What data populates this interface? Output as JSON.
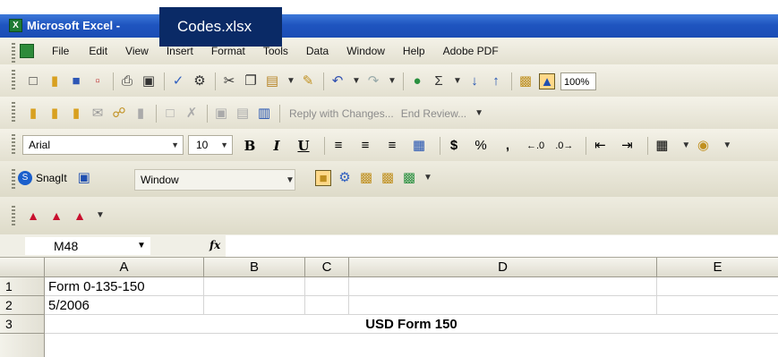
{
  "window": {
    "app_title": "Microsoft Excel -",
    "file_name": "Codes.xlsx",
    "app_icon": "X"
  },
  "menu": {
    "items": [
      "File",
      "Edit",
      "View",
      "Insert",
      "Format",
      "Tools",
      "Data",
      "Window",
      "Help",
      "Adobe PDF"
    ]
  },
  "standard_toolbar": {
    "zoom": "100%"
  },
  "reviewing_toolbar": {
    "reply_label": "Reply with Changes...",
    "end_review_label": "End Review..."
  },
  "formatting_toolbar": {
    "font": "Arial",
    "size": "10",
    "bold": "B",
    "italic": "I",
    "underline": "U",
    "currency": "$",
    "percent": "%",
    "comma": ","
  },
  "snagit_toolbar": {
    "label": "SnagIt",
    "window_select": "Window"
  },
  "formula_bar": {
    "name_box": "M48",
    "fx": "fx",
    "content": ""
  },
  "grid": {
    "columns": [
      "A",
      "B",
      "C",
      "D",
      "E"
    ],
    "rows": [
      {
        "num": "1",
        "a": "Form 0-135-150"
      },
      {
        "num": "2",
        "a": "5/2006"
      },
      {
        "num": "3",
        "title": "USD Form 150"
      }
    ]
  }
}
